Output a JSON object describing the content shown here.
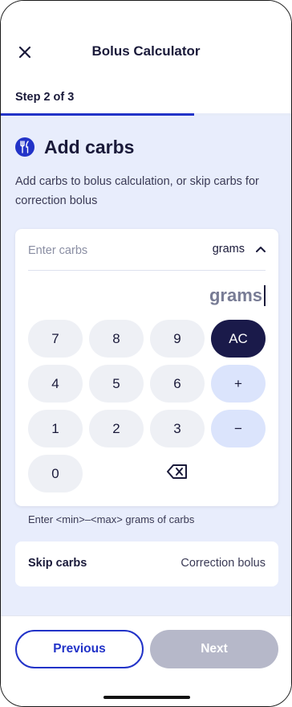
{
  "header": {
    "title": "Bolus Calculator",
    "close_icon": "close-icon"
  },
  "step": {
    "label": "Step 2 of 3",
    "progress": 0.6667
  },
  "section": {
    "icon": "fork-knife-icon",
    "title": "Add carbs",
    "description": "Add carbs to bolus calculation, or skip carbs for correction bolus"
  },
  "carb_input": {
    "placeholder": "Enter carbs",
    "unit": "grams",
    "unit_chevron_icon": "chevron-up-icon",
    "display": "grams"
  },
  "keypad": {
    "keys": [
      {
        "label": "7",
        "type": "digit"
      },
      {
        "label": "8",
        "type": "digit"
      },
      {
        "label": "9",
        "type": "digit"
      },
      {
        "label": "AC",
        "type": "clear"
      },
      {
        "label": "4",
        "type": "digit"
      },
      {
        "label": "5",
        "type": "digit"
      },
      {
        "label": "6",
        "type": "digit"
      },
      {
        "label": "+",
        "type": "operator"
      },
      {
        "label": "1",
        "type": "digit"
      },
      {
        "label": "2",
        "type": "digit"
      },
      {
        "label": "3",
        "type": "digit"
      },
      {
        "label": "−",
        "type": "operator"
      },
      {
        "label": "0",
        "type": "digit"
      },
      {
        "label": "",
        "type": "backspace",
        "icon": "backspace-icon"
      }
    ]
  },
  "hint": "Enter <min>–<max> grams of carbs",
  "skip": {
    "label": "Skip carbs",
    "value": "Correction bolus"
  },
  "footer": {
    "previous_label": "Previous",
    "next_label": "Next"
  },
  "colors": {
    "primary": "#2233c8",
    "content_bg": "#e8edfc",
    "ac_key": "#1a1a4a",
    "op_key": "#dbe4fc",
    "digit_key": "#eef0f5",
    "disabled_button": "#b6b8c9"
  }
}
